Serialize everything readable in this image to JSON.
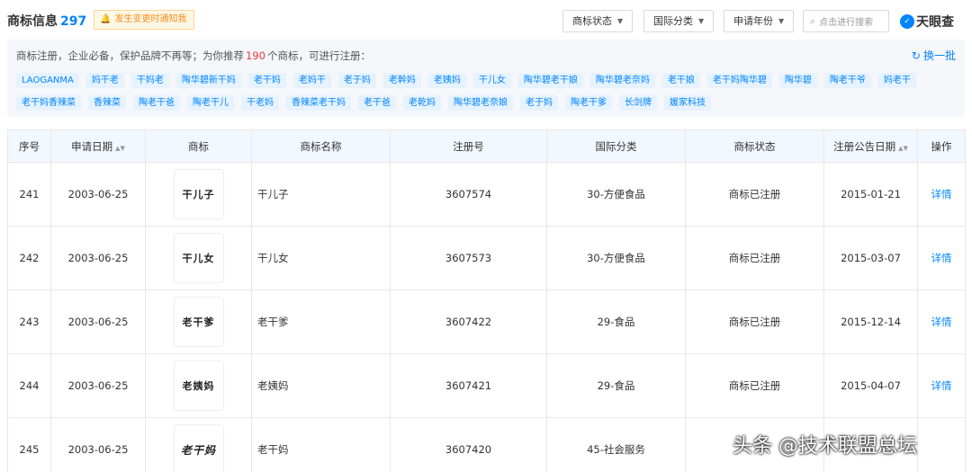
{
  "header": {
    "title": "商标信息",
    "count": "297",
    "notify_label": "发生变更时通知我",
    "filters": [
      "商标状态",
      "国际分类",
      "申请年份"
    ],
    "search_placeholder": "点击进行搜索",
    "brand": "天眼查"
  },
  "recommend": {
    "text_before": "商标注册，企业必备，保护品牌不再等；为你推荐",
    "count": "190",
    "text_after": "个商标，可进行注册：",
    "swap_label": "换一批",
    "tags": [
      "LAOGANMA",
      "妈干老",
      "干妈老",
      "陶华碧新干妈",
      "老干妈",
      "老妈干",
      "老于妈",
      "老幹妈",
      "老姨妈",
      "干儿女",
      "陶华碧老干娘",
      "陶华碧老奈妈",
      "老干娘",
      "老干妈陶华碧",
      "陶华碧",
      "陶老干爷",
      "妈老干",
      "老干妈香辣菜",
      "香辣菜",
      "陶老干爸",
      "陶老干儿",
      "干老妈",
      "香辣菜老干妈",
      "老干爸",
      "老乾妈",
      "陶华碧老奈娘",
      "老于妈",
      "陶老干爹",
      "长剑牌",
      "媛家科技"
    ]
  },
  "table": {
    "columns": [
      "序号",
      "申请日期",
      "商标",
      "商标名称",
      "注册号",
      "国际分类",
      "商标状态",
      "注册公告日期",
      "操作"
    ],
    "rows": [
      {
        "index": "241",
        "apply_date": "2003-06-25",
        "logo_text": "干儿子",
        "name": "干儿子",
        "reg_no": "3607574",
        "class": "30-方便食品",
        "status": "商标已注册",
        "pub_date": "2015-01-21",
        "action": "详情"
      },
      {
        "index": "242",
        "apply_date": "2003-06-25",
        "logo_text": "干儿女",
        "name": "干儿女",
        "reg_no": "3607573",
        "class": "30-方便食品",
        "status": "商标已注册",
        "pub_date": "2015-03-07",
        "action": "详情"
      },
      {
        "index": "243",
        "apply_date": "2003-06-25",
        "logo_text": "老干爹",
        "name": "老干爹",
        "reg_no": "3607422",
        "class": "29-食品",
        "status": "商标已注册",
        "pub_date": "2015-12-14",
        "action": "详情"
      },
      {
        "index": "244",
        "apply_date": "2003-06-25",
        "logo_text": "老姨妈",
        "name": "老姨妈",
        "reg_no": "3607421",
        "class": "29-食品",
        "status": "商标已注册",
        "pub_date": "2015-04-07",
        "action": "详情"
      },
      {
        "index": "245",
        "apply_date": "2003-06-25",
        "logo_text": "老干妈",
        "name": "老干妈",
        "reg_no": "3607420",
        "class": "45-社会服务",
        "status": "",
        "pub_date": "",
        "action": ""
      }
    ]
  },
  "watermark": "头条 @技术联盟总坛"
}
